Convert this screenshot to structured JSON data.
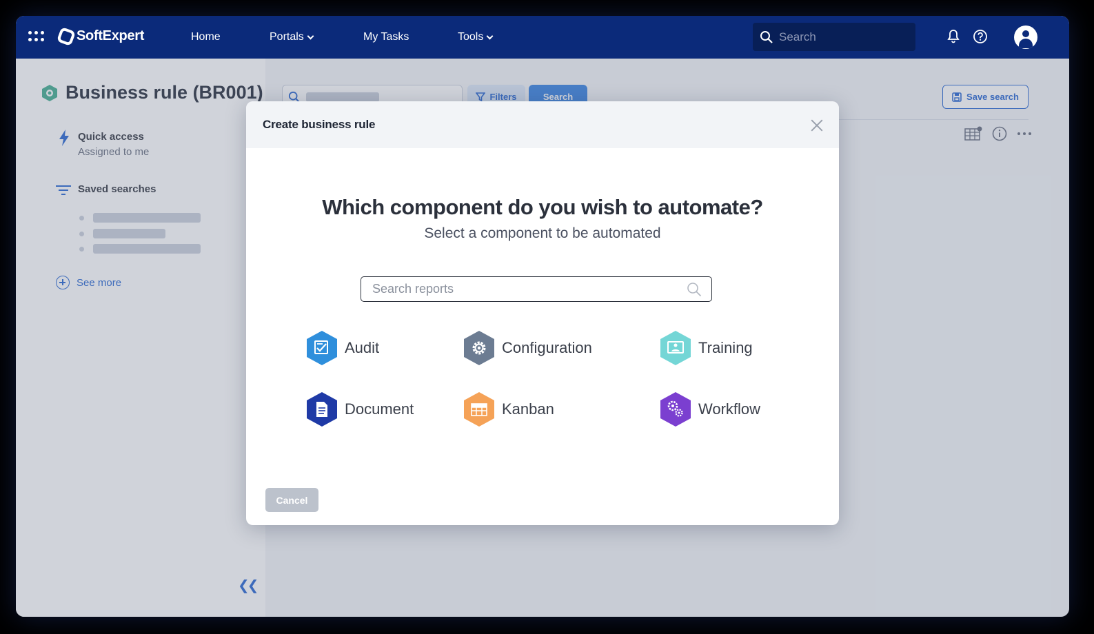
{
  "topbar": {
    "brand": "SoftExpert",
    "nav": [
      {
        "label": "Home"
      },
      {
        "label": "Portals"
      },
      {
        "label": "My Tasks"
      },
      {
        "label": "Tools"
      }
    ],
    "search_placeholder": "Search"
  },
  "sidebar": {
    "title": "Business rule (BR001)",
    "quick_access": "Quick access",
    "quick_access_sub": "Assigned to me",
    "saved_searches": "Saved searches",
    "see_more": "See more"
  },
  "main": {
    "filters_label": "Filters",
    "search_label": "Search",
    "save_search_label": "Save search"
  },
  "modal": {
    "title": "Create business rule",
    "question": "Which component do you wish to automate?",
    "subtitle": "Select a component to be automated",
    "search_placeholder": "Search reports",
    "components": [
      {
        "label": "Audit",
        "icon": "audit-icon",
        "color": "#2f8fdc"
      },
      {
        "label": "Configuration",
        "icon": "gear-icon",
        "color": "#6c7c92"
      },
      {
        "label": "Training",
        "icon": "training-icon",
        "color": "#74d6d6"
      },
      {
        "label": "Document",
        "icon": "document-icon",
        "color": "#1f3aa6"
      },
      {
        "label": "Kanban",
        "icon": "kanban-icon",
        "color": "#f5a257"
      },
      {
        "label": "Workflow",
        "icon": "workflow-icon",
        "color": "#7b3fd0"
      }
    ],
    "cancel_label": "Cancel"
  },
  "colors": {
    "topbar": "#0b2a7a",
    "accent": "#1d5fcf",
    "primary_button": "#2f7de0"
  }
}
